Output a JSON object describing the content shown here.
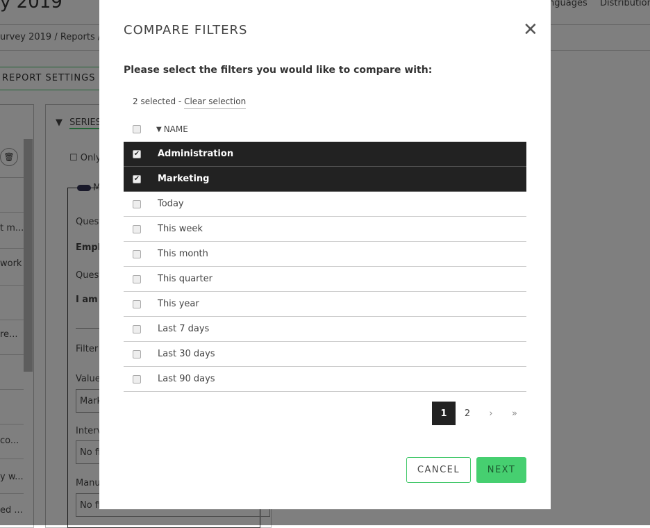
{
  "background": {
    "page_title": "y 2019",
    "breadcrumb": [
      "urvey 2019",
      "Reports"
    ],
    "top_nav": [
      "nguages",
      "Distribution"
    ],
    "report_settings_label": "REPORT SETTINGS",
    "left_list": [
      "t m...",
      "work",
      "re...",
      "co...",
      "y w...",
      "ed ..."
    ],
    "series_label": "SERIES",
    "only_label": "Only",
    "toggle_label": "M",
    "question_label_1": "Quest",
    "question_value_1": "Emplo",
    "question_label_2": "Quest",
    "question_value_2": "I am s",
    "filter_label": "Filter",
    "value_label": "Value",
    "value_input": "Mark",
    "interval_label": "Interv",
    "interval_input": "No fi",
    "manual_label": "Manu",
    "manual_input": "No fi"
  },
  "modal": {
    "title": "COMPARE FILTERS",
    "close_icon": "close-icon",
    "prompt": "Please select the filters you would like to compare with:",
    "selected_count": "2 selected - ",
    "clear_selection": "Clear selection",
    "column_header": "NAME",
    "rows": [
      {
        "name": "Administration",
        "checked": true
      },
      {
        "name": "Marketing",
        "checked": true
      },
      {
        "name": "Today",
        "checked": false
      },
      {
        "name": "This week",
        "checked": false
      },
      {
        "name": "This month",
        "checked": false
      },
      {
        "name": "This quarter",
        "checked": false
      },
      {
        "name": "This year",
        "checked": false
      },
      {
        "name": "Last 7 days",
        "checked": false
      },
      {
        "name": "Last 30 days",
        "checked": false
      },
      {
        "name": "Last 90 days",
        "checked": false
      }
    ],
    "pagination": {
      "current": "1",
      "pages": [
        "1",
        "2"
      ],
      "next": "›",
      "last": "»"
    },
    "cancel_label": "CANCEL",
    "next_label": "NEXT",
    "colors": {
      "accent": "#46cf70",
      "selected_row": "#222222"
    }
  }
}
